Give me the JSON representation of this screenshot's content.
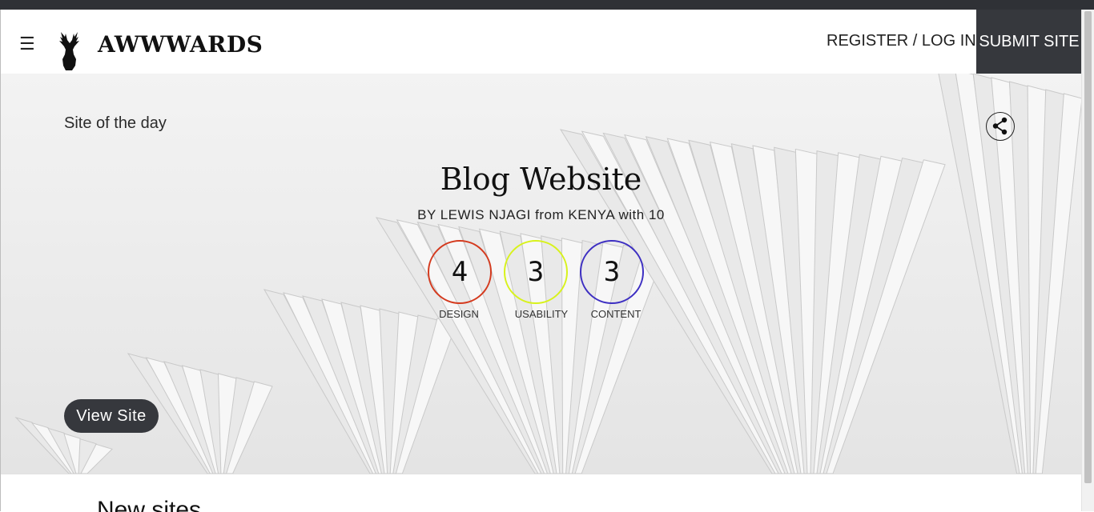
{
  "navbar": {
    "menu_icon": "hamburger-icon",
    "menu_glyph": "☰",
    "brand": "AWWWARDS",
    "register_login": "REGISTER / LOG IN",
    "submit_site": "SUBMIT SITE"
  },
  "hero": {
    "label": "Site of the day",
    "title": "Blog Website",
    "byline": "BY LEWIS NJAGI from KENYA with 10",
    "share_icon": "share-icon",
    "scores": [
      {
        "value": "4",
        "label": "DESIGN",
        "color": "#d43a1e"
      },
      {
        "value": "3",
        "label": "USABILITY",
        "color": "#d8f21c"
      },
      {
        "value": "3",
        "label": "CONTENT",
        "color": "#3d2fc2"
      }
    ],
    "view_site": "View Site"
  },
  "below": {
    "title": "New sites"
  }
}
